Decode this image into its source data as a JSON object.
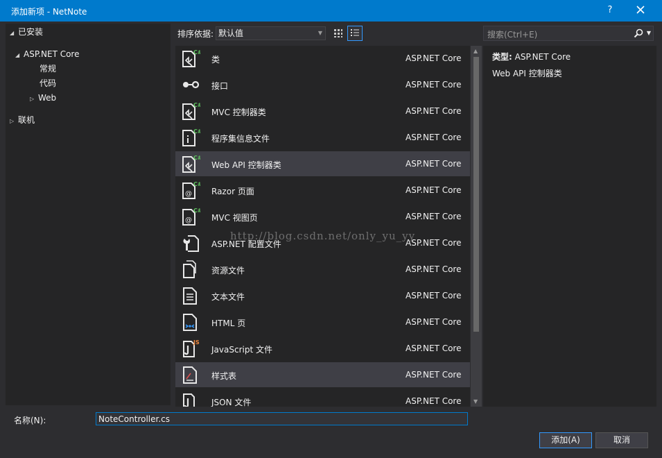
{
  "window": {
    "title": "添加新项 - NetNote",
    "help": "?",
    "close": "✕"
  },
  "tree": {
    "installed": "已安装",
    "aspnet": "ASP.NET Core",
    "general": "常规",
    "code": "代码",
    "web": "Web",
    "online": "联机"
  },
  "toolbar": {
    "sort_label": "排序依据:",
    "sort_value": "默认值",
    "search_placeholder": "搜索(Ctrl+E)"
  },
  "items": [
    {
      "name": "类",
      "category": "ASP.NET Core",
      "icon": "csharp-class-icon"
    },
    {
      "name": "接口",
      "category": "ASP.NET Core",
      "icon": "interface-icon"
    },
    {
      "name": "MVC 控制器类",
      "category": "ASP.NET Core",
      "icon": "csharp-controller-icon"
    },
    {
      "name": "程序集信息文件",
      "category": "ASP.NET Core",
      "icon": "assembly-info-icon"
    },
    {
      "name": "Web API 控制器类",
      "category": "ASP.NET Core",
      "icon": "csharp-controller-icon"
    },
    {
      "name": "Razor 页面",
      "category": "ASP.NET Core",
      "icon": "razor-page-icon"
    },
    {
      "name": "MVC 视图页",
      "category": "ASP.NET Core",
      "icon": "razor-view-icon"
    },
    {
      "name": "ASP.NET 配置文件",
      "category": "ASP.NET Core",
      "icon": "config-file-icon"
    },
    {
      "name": "资源文件",
      "category": "ASP.NET Core",
      "icon": "resource-file-icon"
    },
    {
      "name": "文本文件",
      "category": "ASP.NET Core",
      "icon": "text-file-icon"
    },
    {
      "name": "HTML 页",
      "category": "ASP.NET Core",
      "icon": "html-page-icon"
    },
    {
      "name": "JavaScript 文件",
      "category": "ASP.NET Core",
      "icon": "javascript-file-icon"
    },
    {
      "name": "样式表",
      "category": "ASP.NET Core",
      "icon": "stylesheet-icon"
    },
    {
      "name": "JSON 文件",
      "category": "ASP.NET Core",
      "icon": "json-file-icon"
    }
  ],
  "detail": {
    "type_label": "类型:",
    "type_value": "ASP.NET Core",
    "description": "Web API 控制器类"
  },
  "watermark": "http://blog.csdn.net/only_yu_yy",
  "footer": {
    "name_label": "名称(N):",
    "name_value": "NoteController.cs",
    "add_button": "添加(A)",
    "cancel_button": "取消"
  },
  "colors": {
    "accent": "#007acc",
    "background": "#2d2d30",
    "panel": "#252526",
    "highlight": "#3f3f46",
    "csharp_badge": "#5fc35f",
    "js_badge": "#f0883e"
  }
}
